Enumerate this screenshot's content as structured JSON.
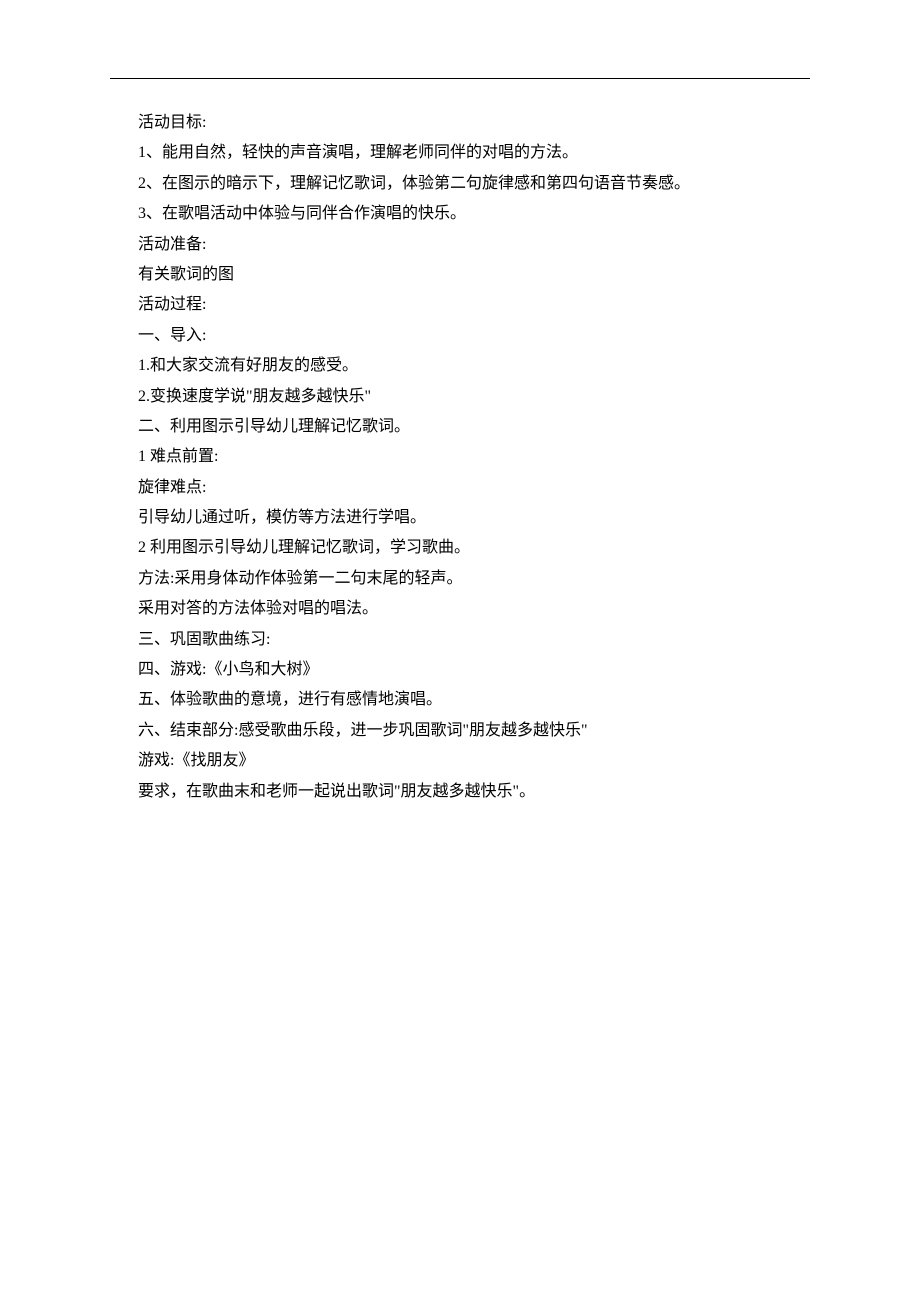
{
  "lines": [
    "活动目标:",
    "1、能用自然，轻快的声音演唱，理解老师同伴的对唱的方法。",
    "2、在图示的暗示下，理解记忆歌词，体验第二句旋律感和第四句语音节奏感。",
    "3、在歌唱活动中体验与同伴合作演唱的快乐。",
    "活动准备:",
    "有关歌词的图",
    "活动过程:",
    "一、导入:",
    "1.和大家交流有好朋友的感受。",
    "2.变换速度学说\"朋友越多越快乐\"",
    "二、利用图示引导幼儿理解记忆歌词。",
    "1 难点前置:",
    "旋律难点:",
    "引导幼儿通过听，模仿等方法进行学唱。",
    "2 利用图示引导幼儿理解记忆歌词，学习歌曲。",
    "方法:采用身体动作体验第一二句末尾的轻声。",
    "采用对答的方法体验对唱的唱法。",
    "三、巩固歌曲练习:",
    "四、游戏:《小鸟和大树》",
    "五、体验歌曲的意境，进行有感情地演唱。",
    "六、结束部分:感受歌曲乐段，进一步巩固歌词\"朋友越多越快乐\"",
    "游戏:《找朋友》",
    "要求，在歌曲末和老师一起说出歌词\"朋友越多越快乐\"。"
  ]
}
